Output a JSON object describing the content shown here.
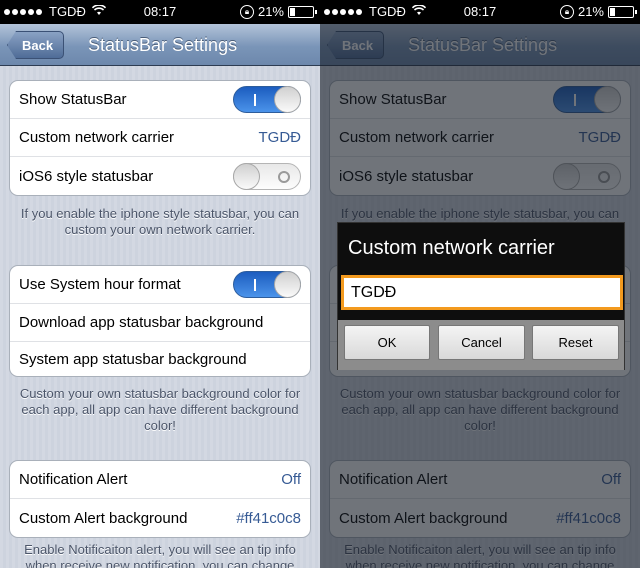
{
  "statusbar": {
    "carrier": "TGDĐ",
    "time": "08:17",
    "battery": "21%",
    "battery_level": 0.21
  },
  "navbar": {
    "back_label": "Back",
    "title": "StatusBar Settings"
  },
  "group1": {
    "show_statusbar": {
      "label": "Show StatusBar",
      "on": true
    },
    "custom_carrier": {
      "label": "Custom network carrier",
      "value": "TGDĐ"
    },
    "ios6_style": {
      "label": "iOS6 style statusbar",
      "on": false
    }
  },
  "footer1": "If you enable the iphone style statusbar, you can custom your own network carrier.",
  "group2": {
    "system_hour": {
      "label": "Use System hour format",
      "on": true
    },
    "download_bg": {
      "label": "Download app statusbar background"
    },
    "system_bg": {
      "label": "System app statusbar background"
    }
  },
  "footer2": "Custom your own statusbar background color for each app, all app can have different background color!",
  "group3": {
    "notification_alert": {
      "label": "Notification Alert",
      "value": "Off"
    },
    "custom_alert_bg": {
      "label": "Custom Alert background",
      "value": "#ff41c0c8"
    }
  },
  "footer3": "Enable Notificaiton alert, you will see an tip info when receive new notification, you can change",
  "dialog": {
    "title": "Custom network carrier",
    "input_value": "TGDĐ",
    "ok_label": "OK",
    "cancel_label": "Cancel",
    "reset_label": "Reset"
  }
}
